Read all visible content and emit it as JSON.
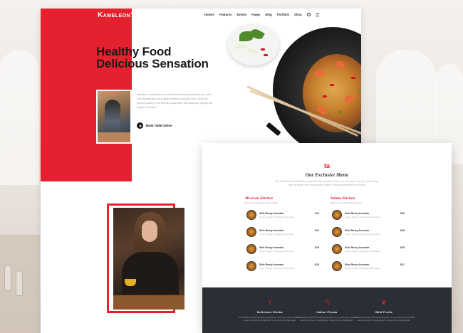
{
  "brand": {
    "logo_k": "K",
    "logo_rest": "AMELEON",
    "logo_sup": "+"
  },
  "nav": [
    "Homes",
    "Features",
    "Events",
    "Pages",
    "Blog",
    "Portfolio",
    "Shop"
  ],
  "hero": {
    "title_line1": "Healthy Food",
    "title_line2": "Delicious Sensation",
    "text": "Kameleon restaurant and have the best food experience you have ever desired with our unique creation of people over it done for famous spices in the best and guarantee that usual any people like enjoys Kameleon.",
    "cta_label": "Book Table Online"
  },
  "menu": {
    "logo": "ta",
    "title": "Our Exclusive Menu",
    "subtitle": "Get the best food experience in your life with Kameleon menu. Let us enjoy of our joy, which enjoys with my whole heart and taste the charm of delicious experience of a year.",
    "columns": [
      {
        "title": "Mexican Kitchen",
        "subtitle": "Browse our Mexican kitchen dishes",
        "items": [
          {
            "name": "Side Rosty Avocado",
            "desc": "Lemon, Ginger, Chili pepper with sauce",
            "price": "$16"
          },
          {
            "name": "Side Rosty Avocado",
            "desc": "Lemon, Ginger, Chili pepper with sauce",
            "price": "$21"
          },
          {
            "name": "Side Rosty Avocado",
            "desc": "Lemon, Ginger, Chili pepper with sauce",
            "price": "$18"
          },
          {
            "name": "Side Rosty Avocado",
            "desc": "Lemon, Ginger, Chili pepper with sauce",
            "price": "$15"
          }
        ]
      },
      {
        "title": "Italian Kitchen",
        "subtitle": "Browse our Italian kitchen dishes",
        "items": [
          {
            "name": "Side Rosty Avocado",
            "desc": "Lemon, Ginger, Chili pepper with sauce",
            "price": "$16"
          },
          {
            "name": "Side Rosty Avocado",
            "desc": "Lemon, Ginger, Chili pepper with sauce",
            "price": "$18"
          },
          {
            "name": "Side Rosty Avocado",
            "desc": "Lemon, Ginger, Chili pepper with sauce",
            "price": "$15"
          },
          {
            "name": "Side Rosty Avocado",
            "desc": "Lemon, Ginger, Chili pepper with sauce",
            "price": "$21"
          }
        ]
      }
    ]
  },
  "features": [
    {
      "title": "Delicious Drinks",
      "text": "A wonderful serenity has taken possession of my entire soul, like these sweet mornings of spring which I enjoy with my whole heart.",
      "icon": "cocktail-icon",
      "glyph": "Y"
    },
    {
      "title": "Italian Pizzas",
      "text": "A wonderful serenity has taken possession of my entire soul, like these sweet mornings of spring which I enjoy with my whole heart.",
      "icon": "pizza-icon",
      "glyph": "◹"
    },
    {
      "title": "Wild Fruits",
      "text": "A wonderful serenity has taken possession of my entire soul, like these sweet mornings of spring which I enjoy with my whole heart.",
      "icon": "leaf-icon",
      "glyph": "❦"
    }
  ],
  "colors": {
    "accent": "#e4212f",
    "dark": "#2a2e35",
    "text": "#1b1b1b"
  }
}
